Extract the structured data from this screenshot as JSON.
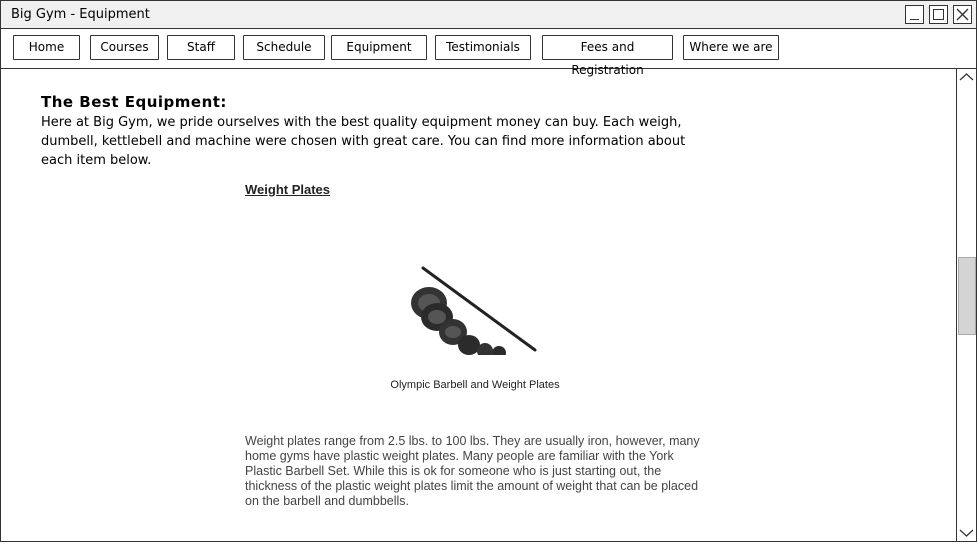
{
  "window": {
    "title": "Big Gym - Equipment"
  },
  "nav": [
    {
      "label": "Home"
    },
    {
      "label": "Courses"
    },
    {
      "label": "Staff"
    },
    {
      "label": "Schedule"
    },
    {
      "label": "Equipment"
    },
    {
      "label": "Testimonials"
    },
    {
      "label": "Fees and Registration"
    },
    {
      "label": "Where we are"
    }
  ],
  "main": {
    "heading": "The Best Equipment:",
    "intro": "Here at Big Gym,  we pride ourselves with the best quality equipment money can buy. Each weigh,  dumbell, kettlebell and machine were chosen with great care. You can find more information about each item below.",
    "section": {
      "title": "Weight Plates",
      "image_caption": "Olympic Barbell and Weight Plates",
      "description": "Weight plates range from 2.5 lbs. to 100 lbs. They are usually iron, however, many home gyms have plastic weight plates. Many people are familiar with the York Plastic Barbell Set. While this is ok for someone who is just starting out, the thickness of the plastic weight plates limit the amount of weight that can be placed on the barbell and dumbbells."
    }
  },
  "icons": {
    "minimize": "minimize-icon",
    "maximize": "maximize-icon",
    "close": "close-icon",
    "scroll_up": "chevron-up-icon",
    "scroll_down": "chevron-down-icon"
  }
}
